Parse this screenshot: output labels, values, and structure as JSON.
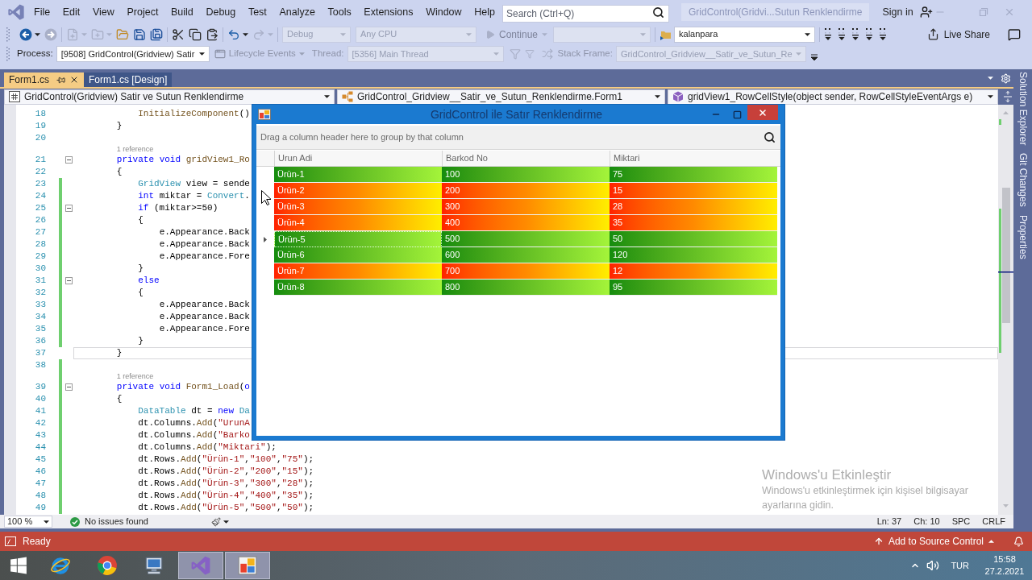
{
  "menu_bar": {
    "items": [
      "File",
      "Edit",
      "View",
      "Project",
      "Build",
      "Debug",
      "Test",
      "Analyze",
      "Tools",
      "Extensions",
      "Window",
      "Help"
    ],
    "search": {
      "placeholder": "Search (Ctrl+Q)"
    },
    "solution_title": "GridControl(Gridvi...Sutun Renklendirme",
    "sign_in": "Sign in"
  },
  "standard_toolbar": {
    "icon_buttons": [
      {
        "disabled": false
      },
      {
        "disabled": true
      },
      {
        "disabled": true
      },
      {
        "disabled": true
      },
      {
        "disabled": false
      },
      {
        "disabled": false
      },
      {
        "disabled": false
      },
      {
        "disabled": false
      },
      {
        "disabled": false
      },
      {
        "disabled": false
      },
      {
        "disabled": false
      },
      {
        "disabled": true
      },
      {
        "disabled": false
      },
      {
        "disabled": false
      },
      {
        "disabled": false
      },
      {
        "disabled": false
      },
      {
        "disabled": false
      },
      {
        "disabled": false
      }
    ],
    "configuration": {
      "value": "Debug",
      "disabled": true
    },
    "platform": {
      "value": "Any CPU",
      "disabled": true
    },
    "continue_button": {
      "label": "Continue",
      "disabled": true
    },
    "target_combo": {
      "disabled": true
    },
    "startup_project": {
      "value": "kalanpara",
      "disabled": false
    },
    "live_share": "Live Share"
  },
  "debug_location_toolbar": {
    "process": {
      "label": "Process:",
      "value": "[9508] GridControl(Gridview) Satir",
      "disabled": false
    },
    "lifecycle_events": {
      "label": "Lifecycle Events",
      "disabled": true
    },
    "thread": {
      "label": "Thread:",
      "value": "[5356] Main Thread",
      "disabled": true
    },
    "icon_buttons": [
      {
        "disabled": true
      },
      {
        "disabled": true
      },
      {
        "disabled": true
      }
    ],
    "stack_frame": {
      "label": "Stack Frame:",
      "value": "GridControl_Gridview__Satir_ve_Sutun_Re",
      "disabled": true
    }
  },
  "document_tabs": [
    {
      "label": "Form1.cs",
      "selected": true
    },
    {
      "label": "Form1.cs [Design]",
      "selected": false
    }
  ],
  "navigation_bar": {
    "project": "GridControl(Gridview) Satir ve Sutun Renklendirme",
    "type": "GridControl_Gridview__Satir_ve_Sutun_Renklendirme.Form1",
    "member": "gridView1_RowCellStyle(object sender, RowCellStyleEventArgs e)"
  },
  "editor": {
    "lines": [
      {
        "kind": "code",
        "number": "18",
        "code": [
          {
            "kind": "method",
            "text": "            InitializeComponent"
          },
          {
            "kind": "plain",
            "text": "()"
          }
        ],
        "fold": false,
        "changed": false,
        "current": false
      },
      {
        "kind": "code",
        "number": "19",
        "code": [
          {
            "kind": "plain",
            "text": "        }"
          }
        ],
        "fold": false,
        "changed": false,
        "current": false
      },
      {
        "kind": "code",
        "number": "20",
        "fold": false,
        "changed": false,
        "current": false
      },
      {
        "kind": "lens",
        "text": "        1 reference",
        "changed": false
      },
      {
        "kind": "code",
        "number": "21",
        "code": [
          {
            "kind": "keyword",
            "text": "        private"
          },
          {
            "kind": "keyword",
            "text": " void"
          },
          {
            "kind": "method",
            "text": " gridView1_Ro"
          }
        ],
        "fold": true,
        "changed": false,
        "current": false
      },
      {
        "kind": "code",
        "number": "22",
        "code": [
          {
            "kind": "plain",
            "text": "        {"
          }
        ],
        "fold": false,
        "changed": false,
        "current": false
      },
      {
        "kind": "code",
        "number": "23",
        "code": [
          {
            "kind": "type",
            "text": "            GridView"
          },
          {
            "kind": "plain",
            "text": " view = sende"
          }
        ],
        "fold": false,
        "changed": true,
        "current": false
      },
      {
        "kind": "code",
        "number": "24",
        "code": [
          {
            "kind": "keyword",
            "text": "            int"
          },
          {
            "kind": "plain",
            "text": " miktar = "
          },
          {
            "kind": "type",
            "text": "Convert"
          },
          {
            "kind": "plain",
            "text": "."
          }
        ],
        "fold": false,
        "changed": true,
        "current": false
      },
      {
        "kind": "code",
        "number": "25",
        "code": [
          {
            "kind": "keyword",
            "text": "            if"
          },
          {
            "kind": "plain",
            "text": " (miktar>=50)"
          }
        ],
        "fold": true,
        "changed": true,
        "current": false
      },
      {
        "kind": "code",
        "number": "26",
        "code": [
          {
            "kind": "plain",
            "text": "            {"
          }
        ],
        "fold": false,
        "changed": true,
        "current": false
      },
      {
        "kind": "code",
        "number": "27",
        "code": [
          {
            "kind": "plain",
            "text": "                e.Appearance.Back"
          }
        ],
        "fold": false,
        "changed": true,
        "current": false
      },
      {
        "kind": "code",
        "number": "28",
        "code": [
          {
            "kind": "plain",
            "text": "                e.Appearance.Back"
          }
        ],
        "fold": false,
        "changed": true,
        "current": false
      },
      {
        "kind": "code",
        "number": "29",
        "code": [
          {
            "kind": "plain",
            "text": "                e.Appearance.Fore"
          }
        ],
        "fold": false,
        "changed": true,
        "current": false
      },
      {
        "kind": "code",
        "number": "30",
        "code": [
          {
            "kind": "plain",
            "text": "            }"
          }
        ],
        "fold": false,
        "changed": true,
        "current": false
      },
      {
        "kind": "code",
        "number": "31",
        "code": [
          {
            "kind": "keyword",
            "text": "            else"
          }
        ],
        "fold": true,
        "changed": true,
        "current": false
      },
      {
        "kind": "code",
        "number": "32",
        "code": [
          {
            "kind": "plain",
            "text": "            {"
          }
        ],
        "fold": false,
        "changed": true,
        "current": false
      },
      {
        "kind": "code",
        "number": "33",
        "code": [
          {
            "kind": "plain",
            "text": "                e.Appearance.Back"
          }
        ],
        "fold": false,
        "changed": true,
        "current": false
      },
      {
        "kind": "code",
        "number": "34",
        "code": [
          {
            "kind": "plain",
            "text": "                e.Appearance.Back"
          }
        ],
        "fold": false,
        "changed": true,
        "current": false
      },
      {
        "kind": "code",
        "number": "35",
        "code": [
          {
            "kind": "plain",
            "text": "                e.Appearance.Fore"
          }
        ],
        "fold": false,
        "changed": true,
        "current": false
      },
      {
        "kind": "code",
        "number": "36",
        "code": [
          {
            "kind": "plain",
            "text": "            }"
          }
        ],
        "fold": false,
        "changed": true,
        "current": false
      },
      {
        "kind": "code",
        "number": "37",
        "code": [
          {
            "kind": "plain",
            "text": "        }"
          }
        ],
        "fold": false,
        "changed": false,
        "current": true
      },
      {
        "kind": "code",
        "number": "38",
        "fold": false,
        "changed": true,
        "current": false
      },
      {
        "kind": "lens",
        "text": "        1 reference",
        "changed": true
      },
      {
        "kind": "code",
        "number": "39",
        "code": [
          {
            "kind": "keyword",
            "text": "        private"
          },
          {
            "kind": "keyword",
            "text": " void"
          },
          {
            "kind": "method",
            "text": " Form1_Load"
          },
          {
            "kind": "plain",
            "text": "("
          },
          {
            "kind": "keyword",
            "text": "o"
          }
        ],
        "fold": true,
        "changed": true,
        "current": false
      },
      {
        "kind": "code",
        "number": "40",
        "code": [
          {
            "kind": "plain",
            "text": "        {"
          }
        ],
        "fold": false,
        "changed": true,
        "current": false
      },
      {
        "kind": "code",
        "number": "41",
        "code": [
          {
            "kind": "type",
            "text": "            DataTable"
          },
          {
            "kind": "plain",
            "text": " dt = "
          },
          {
            "kind": "keyword",
            "text": "new"
          },
          {
            "kind": "type",
            "text": " Da"
          }
        ],
        "fold": false,
        "changed": true,
        "current": false
      },
      {
        "kind": "code",
        "number": "42",
        "code": [
          {
            "kind": "plain",
            "text": "            dt.Columns."
          },
          {
            "kind": "method",
            "text": "Add"
          },
          {
            "kind": "plain",
            "text": "("
          },
          {
            "kind": "string",
            "text": "\"UrunA"
          }
        ],
        "fold": false,
        "changed": true,
        "current": false
      },
      {
        "kind": "code",
        "number": "43",
        "code": [
          {
            "kind": "plain",
            "text": "            dt.Columns."
          },
          {
            "kind": "method",
            "text": "Add"
          },
          {
            "kind": "plain",
            "text": "("
          },
          {
            "kind": "string",
            "text": "\"Barko"
          }
        ],
        "fold": false,
        "changed": true,
        "current": false
      },
      {
        "kind": "code",
        "number": "44",
        "code": [
          {
            "kind": "plain",
            "text": "            dt.Columns."
          },
          {
            "kind": "method",
            "text": "Add"
          },
          {
            "kind": "plain",
            "text": "("
          },
          {
            "kind": "string",
            "text": "\"Miktari\""
          },
          {
            "kind": "plain",
            "text": ");"
          }
        ],
        "fold": false,
        "changed": true,
        "current": false
      },
      {
        "kind": "code",
        "number": "45",
        "code": [
          {
            "kind": "plain",
            "text": "            dt.Rows."
          },
          {
            "kind": "method",
            "text": "Add"
          },
          {
            "kind": "plain",
            "text": "("
          },
          {
            "kind": "string",
            "text": "\"Ürün-1\""
          },
          {
            "kind": "plain",
            "text": ","
          },
          {
            "kind": "string",
            "text": "\"100\""
          },
          {
            "kind": "plain",
            "text": ","
          },
          {
            "kind": "string",
            "text": "\"75\""
          },
          {
            "kind": "plain",
            "text": ");"
          }
        ],
        "fold": false,
        "changed": true,
        "current": false
      },
      {
        "kind": "code",
        "number": "46",
        "code": [
          {
            "kind": "plain",
            "text": "            dt.Rows."
          },
          {
            "kind": "method",
            "text": "Add"
          },
          {
            "kind": "plain",
            "text": "("
          },
          {
            "kind": "string",
            "text": "\"Ürün-2\""
          },
          {
            "kind": "plain",
            "text": ","
          },
          {
            "kind": "string",
            "text": "\"200\""
          },
          {
            "kind": "plain",
            "text": ","
          },
          {
            "kind": "string",
            "text": "\"15\""
          },
          {
            "kind": "plain",
            "text": ");"
          }
        ],
        "fold": false,
        "changed": true,
        "current": false
      },
      {
        "kind": "code",
        "number": "47",
        "code": [
          {
            "kind": "plain",
            "text": "            dt.Rows."
          },
          {
            "kind": "method",
            "text": "Add"
          },
          {
            "kind": "plain",
            "text": "("
          },
          {
            "kind": "string",
            "text": "\"Ürün-3\""
          },
          {
            "kind": "plain",
            "text": ","
          },
          {
            "kind": "string",
            "text": "\"300\""
          },
          {
            "kind": "plain",
            "text": ","
          },
          {
            "kind": "string",
            "text": "\"28\""
          },
          {
            "kind": "plain",
            "text": ");"
          }
        ],
        "fold": false,
        "changed": true,
        "current": false
      },
      {
        "kind": "code",
        "number": "48",
        "code": [
          {
            "kind": "plain",
            "text": "            dt.Rows."
          },
          {
            "kind": "method",
            "text": "Add"
          },
          {
            "kind": "plain",
            "text": "("
          },
          {
            "kind": "string",
            "text": "\"Ürün-4\""
          },
          {
            "kind": "plain",
            "text": ","
          },
          {
            "kind": "string",
            "text": "\"400\""
          },
          {
            "kind": "plain",
            "text": ","
          },
          {
            "kind": "string",
            "text": "\"35\""
          },
          {
            "kind": "plain",
            "text": ");"
          }
        ],
        "fold": false,
        "changed": true,
        "current": false
      },
      {
        "kind": "code",
        "number": "49",
        "code": [
          {
            "kind": "plain",
            "text": "            dt.Rows."
          },
          {
            "kind": "method",
            "text": "Add"
          },
          {
            "kind": "plain",
            "text": "("
          },
          {
            "kind": "string",
            "text": "\"Ürün-5\""
          },
          {
            "kind": "plain",
            "text": ","
          },
          {
            "kind": "string",
            "text": "\"500\""
          },
          {
            "kind": "plain",
            "text": ","
          },
          {
            "kind": "string",
            "text": "\"50\""
          },
          {
            "kind": "plain",
            "text": ");"
          }
        ],
        "fold": false,
        "changed": true,
        "current": false
      }
    ],
    "zoom": "100 %",
    "issues": "No issues found",
    "caret_line": "Ln: 37",
    "caret_column": "Ch: 10",
    "whitespace": "SPC",
    "line_ending": "CRLF"
  },
  "tool_window_tabs": [
    "Solution Explorer",
    "Git Changes",
    "Properties"
  ],
  "form_window": {
    "title": "GridControl ile Satır Renklendirme",
    "group_panel": "Drag a column header here to group by that column",
    "columns": [
      "Urun Adi",
      "Barkod No",
      "Miktari"
    ],
    "rows": [
      {
        "cells": [
          "Ürün-1",
          "100",
          "75"
        ],
        "kind": "green",
        "focused": false
      },
      {
        "cells": [
          "Ürün-2",
          "200",
          "15"
        ],
        "kind": "red",
        "focused": false
      },
      {
        "cells": [
          "Ürün-3",
          "300",
          "28"
        ],
        "kind": "red",
        "focused": false
      },
      {
        "cells": [
          "Ürün-4",
          "400",
          "35"
        ],
        "kind": "red",
        "focused": false
      },
      {
        "cells": [
          "Ürün-5",
          "500",
          "50"
        ],
        "kind": "green",
        "focused": true
      },
      {
        "cells": [
          "Ürün-6",
          "600",
          "120"
        ],
        "kind": "green",
        "focused": false
      },
      {
        "cells": [
          "Ürün-7",
          "700",
          "12"
        ],
        "kind": "red",
        "focused": false
      },
      {
        "cells": [
          "Ürün-8",
          "800",
          "95"
        ],
        "kind": "green",
        "focused": false
      }
    ]
  },
  "activation_notice": {
    "title": "Windows'u Etkinleştir",
    "text": "Windows'u etkinleştirmek için kişisel bilgisayar ayarlarına gidin."
  },
  "status_bar": {
    "text": "Ready",
    "source_control": "Add to Source Control"
  },
  "taskbar": {
    "apps": [
      {
        "active": false
      },
      {
        "active": false
      },
      {
        "active": false
      },
      {
        "active": true
      },
      {
        "active": true
      }
    ],
    "language": "TUR",
    "time": "15:58",
    "date": "27.2.2021"
  }
}
